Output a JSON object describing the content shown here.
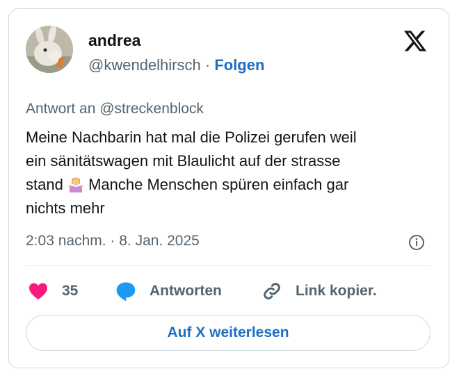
{
  "author": {
    "name": "andrea",
    "handle": "@kwendelhirsch",
    "separator": "·",
    "follow_label": "Folgen"
  },
  "tweet": {
    "reply_to": "Antwort an @streckenblock",
    "lines": [
      "Meine Nachbarin hat mal die Polizei gerufen weil",
      "ein sänitätswagen mit Blaulicht auf der strasse",
      "stand",
      "Manche Menschen spüren einfach gar",
      "nichts mehr"
    ],
    "emoji": "person-shrugging-emoji",
    "timestamp": "2:03 nachm. · 8. Jan. 2025"
  },
  "actions": {
    "like_count": "35",
    "reply_label": "Antworten",
    "copy_link_label": "Link kopier."
  },
  "read_more_label": "Auf X weiterlesen",
  "colors": {
    "accent": "#1d6fc4",
    "like": "#f91880",
    "reply_bubble": "#1d9bf0",
    "text": "#0f1419",
    "muted": "#536471",
    "border": "#cfd9de"
  },
  "icons": {
    "logo": "x-logo-icon",
    "info": "info-icon",
    "like": "heart-icon",
    "reply": "speech-bubble-icon",
    "copy_link": "link-icon"
  }
}
